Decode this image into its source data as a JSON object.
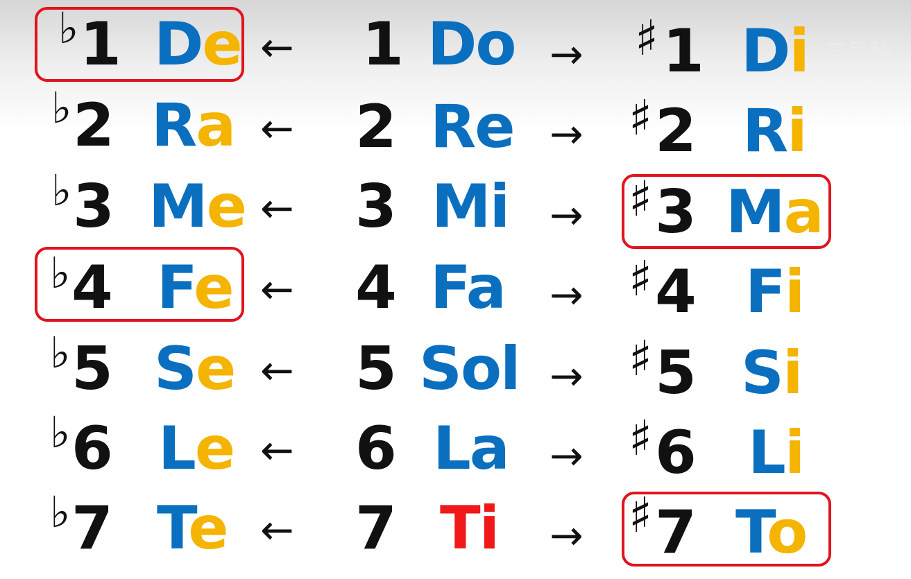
{
  "watermark": "三号种",
  "rows": [
    {
      "flat_num": "1",
      "flat_syl": "D",
      "flat_suffix": "e",
      "base_num": "1",
      "base_syl": "Do",
      "base_suffix": "",
      "sharp_num": "1",
      "sharp_syl": "D",
      "sharp_suffix": "i",
      "flat_acc": "♭",
      "sharp_acc": "♯",
      "left_arrow": "←",
      "right_arrow": "→"
    },
    {
      "flat_num": "2",
      "flat_syl": "R",
      "flat_suffix": "a",
      "base_num": "2",
      "base_syl": "Re",
      "base_suffix": "",
      "sharp_num": "2",
      "sharp_syl": "R",
      "sharp_suffix": "i",
      "flat_acc": "♭",
      "sharp_acc": "♯",
      "left_arrow": "←",
      "right_arrow": "→"
    },
    {
      "flat_num": "3",
      "flat_syl": "M",
      "flat_suffix": "e",
      "base_num": "3",
      "base_syl": "Mi",
      "base_suffix": "",
      "sharp_num": "3",
      "sharp_syl": "M",
      "sharp_suffix": "a",
      "flat_acc": "♭",
      "sharp_acc": "♯",
      "left_arrow": "←",
      "right_arrow": "→"
    },
    {
      "flat_num": "4",
      "flat_syl": "F",
      "flat_suffix": "e",
      "base_num": "4",
      "base_syl": "Fa",
      "base_suffix": "",
      "sharp_num": "4",
      "sharp_syl": "F",
      "sharp_suffix": "i",
      "flat_acc": "♭",
      "sharp_acc": "♯",
      "left_arrow": "←",
      "right_arrow": "→"
    },
    {
      "flat_num": "5",
      "flat_syl": "S",
      "flat_suffix": "e",
      "base_num": "5",
      "base_syl": "Sol",
      "base_suffix": "",
      "sharp_num": "5",
      "sharp_syl": "S",
      "sharp_suffix": "i",
      "flat_acc": "♭",
      "sharp_acc": "♯",
      "left_arrow": "←",
      "right_arrow": "→"
    },
    {
      "flat_num": "6",
      "flat_syl": "L",
      "flat_suffix": "e",
      "base_num": "6",
      "base_syl": "La",
      "base_suffix": "",
      "sharp_num": "6",
      "sharp_syl": "L",
      "sharp_suffix": "i",
      "flat_acc": "♭",
      "sharp_acc": "♯",
      "left_arrow": "←",
      "right_arrow": "→"
    },
    {
      "flat_num": "7",
      "flat_syl": "T",
      "flat_suffix": "e",
      "base_num": "7",
      "base_syl": "Ti",
      "base_suffix": "",
      "sharp_num": "7",
      "sharp_syl": "T",
      "sharp_suffix": "o",
      "flat_acc": "♭",
      "sharp_acc": "♯",
      "left_arrow": "←",
      "right_arrow": "→"
    }
  ],
  "highlights": [
    "flat-1",
    "sharp-3",
    "flat-4",
    "sharp-7"
  ],
  "colors": {
    "blue": "#0b6fbf",
    "yellow": "#f4b400",
    "red": "#f01818",
    "highlight_border": "#e0141c"
  }
}
